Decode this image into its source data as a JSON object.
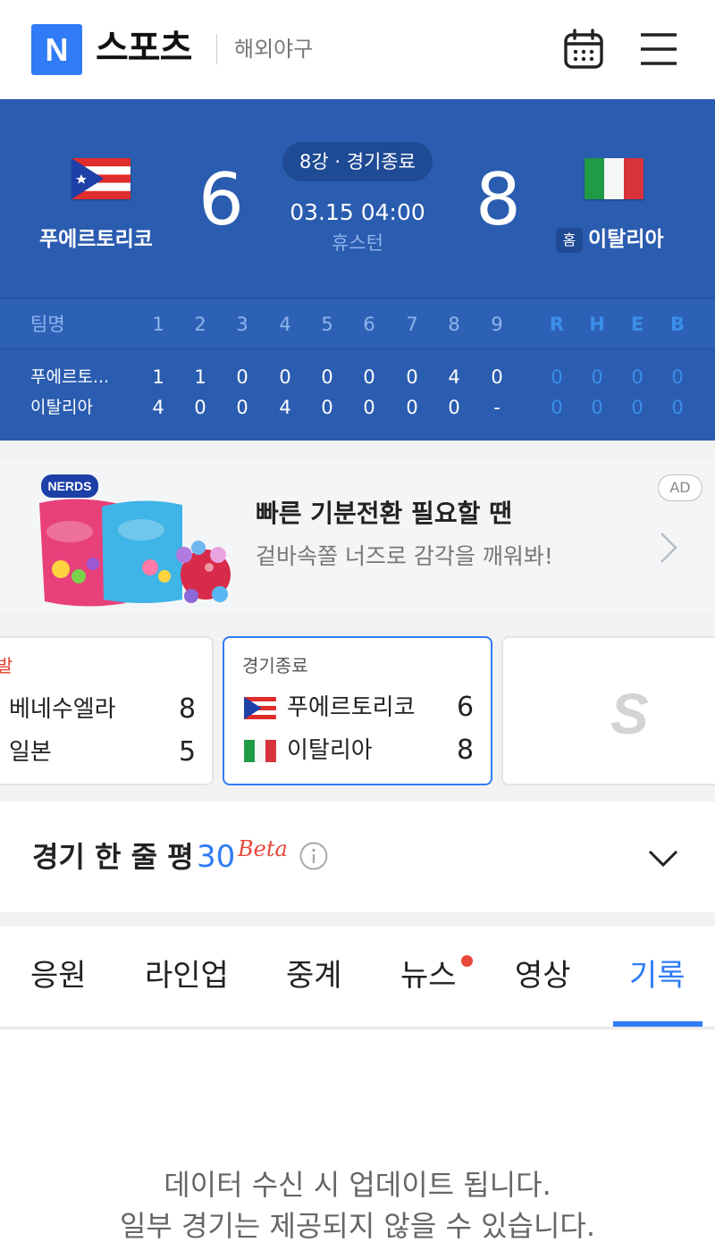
{
  "header": {
    "logo": "N",
    "brand": "스포츠",
    "section": "해외야구",
    "calendar_icon": "calendar-icon",
    "menu_icon": "hamburger-menu-icon"
  },
  "game": {
    "status": "8강 · 경기종료",
    "datetime": "03.15 04:00",
    "venue": "휴스턴",
    "home_badge": "홈",
    "away": {
      "name": "푸에르토리코",
      "score": "6",
      "flag": "puerto-rico-flag"
    },
    "home": {
      "name": "이탈리아",
      "score": "8",
      "flag": "italy-flag"
    }
  },
  "linescore": {
    "header_team": "팀명",
    "innings": [
      "1",
      "2",
      "3",
      "4",
      "5",
      "6",
      "7",
      "8",
      "9"
    ],
    "extras": [
      "R",
      "H",
      "E",
      "B"
    ],
    "rows": [
      {
        "team": "푸에르토...",
        "innings": [
          "1",
          "1",
          "0",
          "0",
          "0",
          "0",
          "0",
          "4",
          "0"
        ],
        "extras": [
          "0",
          "0",
          "0",
          "0"
        ]
      },
      {
        "team": "이탈리아",
        "innings": [
          "4",
          "0",
          "0",
          "4",
          "0",
          "0",
          "0",
          "0",
          "-"
        ],
        "extras": [
          "0",
          "0",
          "0",
          "0"
        ]
      }
    ]
  },
  "ad": {
    "badge": "AD",
    "title": "빠른 기분전환 필요할 땐",
    "subtitle": "겉바속쫄 너즈로 감각을 깨워봐!",
    "product": "NERDS"
  },
  "games": {
    "prev": {
      "status_fragment": "발",
      "away": {
        "name": "베네수엘라",
        "score": "8"
      },
      "home": {
        "name": "일본",
        "score": "5"
      }
    },
    "current": {
      "status": "경기종료",
      "away": {
        "name": "푸에르토리코",
        "score": "6"
      },
      "home": {
        "name": "이탈리아",
        "score": "8"
      }
    },
    "next": {
      "logo": "S"
    }
  },
  "review": {
    "title": "경기 한 줄 평",
    "count": "30",
    "beta": "Beta"
  },
  "tabs": [
    {
      "label": "응원"
    },
    {
      "label": "라인업"
    },
    {
      "label": "중계"
    },
    {
      "label": "뉴스"
    },
    {
      "label": "영상"
    },
    {
      "label": "기록"
    }
  ],
  "active_tab": "기록",
  "empty": {
    "line1": "데이터 수신 시 업데이트 됩니다.",
    "line2": "일부 경기는 제공되지 않을 수 있습니다."
  },
  "colors": {
    "scoreboard_bg": "#2a5cb0",
    "accent": "#2f7cf6",
    "alert": "#e8473a"
  }
}
